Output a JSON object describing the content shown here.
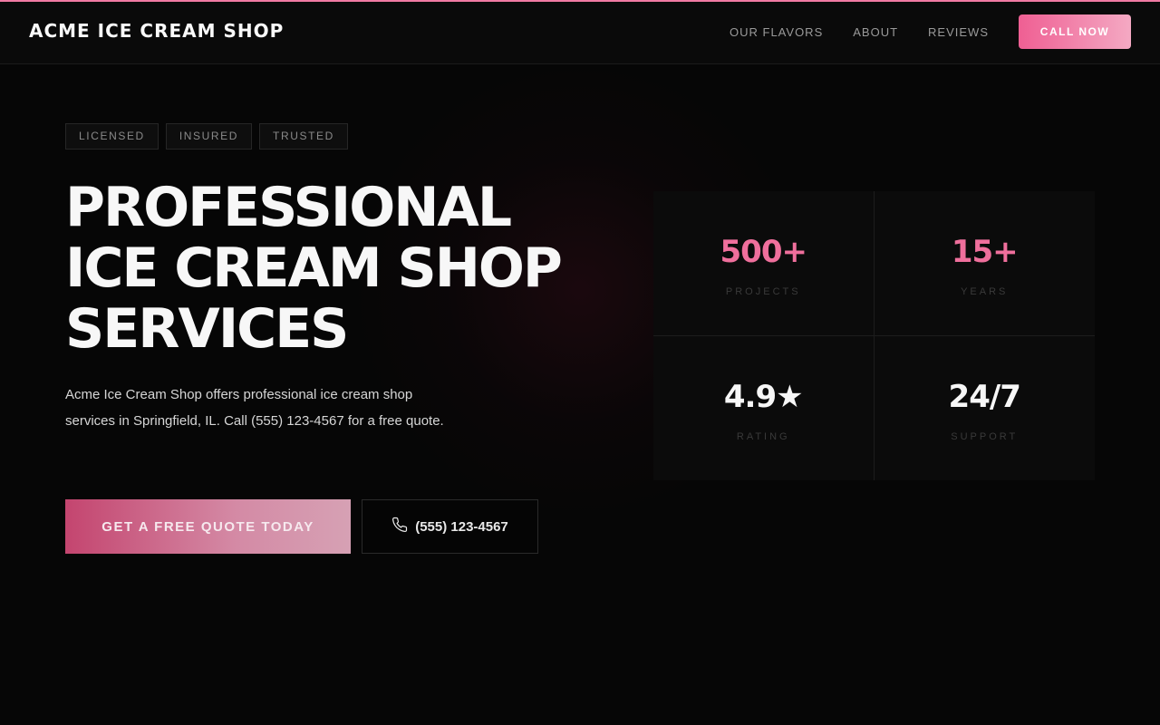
{
  "brand": "ACME ICE CREAM SHOP",
  "nav": {
    "links": [
      "OUR FLAVORS",
      "ABOUT",
      "REVIEWS"
    ],
    "cta": "CALL NOW"
  },
  "badges": [
    "LICENSED",
    "INSURED",
    "TRUSTED"
  ],
  "hero": {
    "title_lines": [
      "PROFESSIONAL",
      "ICE CREAM SHOP",
      "SERVICES"
    ],
    "description": "Acme Ice Cream Shop offers professional ice cream shop services in Springfield, IL. Call (555) 123-4567 for a free quote.",
    "primary_cta": "GET A FREE QUOTE TODAY",
    "phone_cta": "(555) 123-4567"
  },
  "stats": [
    {
      "value": "500+",
      "label": "PROJECTS",
      "color": "#ef6f9c"
    },
    {
      "value": "15+",
      "label": "YEARS",
      "color": "#ef6f9c"
    },
    {
      "value": "4.9★",
      "label": "RATING",
      "color": "#f7f7f7"
    },
    {
      "value": "24/7",
      "label": "SUPPORT",
      "color": "#f7f7f7"
    }
  ],
  "colors": {
    "accent": "#ef5f93",
    "background": "#060606"
  }
}
